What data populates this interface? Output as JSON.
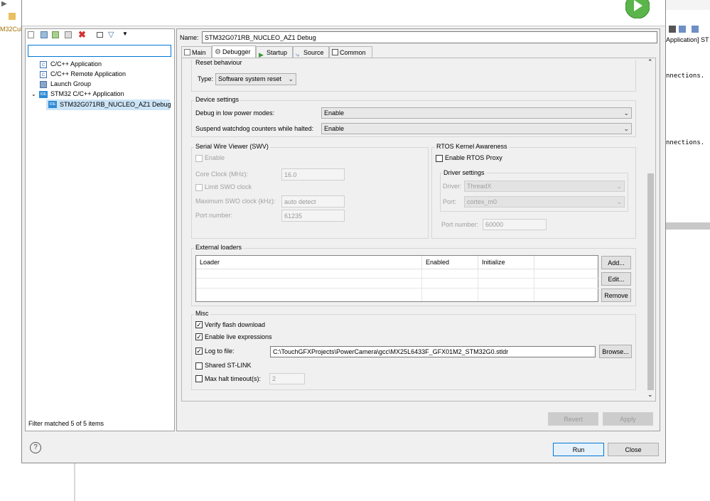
{
  "background": {
    "left_text": "M32Cub",
    "right_lines": [
      "Application] ST",
      "nnections.",
      "nnections."
    ]
  },
  "left": {
    "filter_placeholder": "",
    "tree": [
      {
        "label": "C/C++ Application",
        "icon": "c-app-icon"
      },
      {
        "label": "C/C++ Remote Application",
        "icon": "c-remote-app-icon"
      },
      {
        "label": "Launch Group",
        "icon": "launch-group-icon"
      },
      {
        "label": "STM32 C/C++ Application",
        "icon": "ide-icon"
      },
      {
        "label": "STM32G071RB_NUCLEO_AZ1 Debug",
        "icon": "ide-icon"
      }
    ],
    "status": "Filter matched 5 of 5 items"
  },
  "name": {
    "label": "Name:",
    "value": "STM32G071RB_NUCLEO_AZ1 Debug"
  },
  "tabs": [
    {
      "label": "Main"
    },
    {
      "label": "Debugger"
    },
    {
      "label": "Startup"
    },
    {
      "label": "Source"
    },
    {
      "label": "Common"
    }
  ],
  "reset": {
    "title": "Reset behaviour",
    "type_label": "Type:",
    "type_value": "Software system reset"
  },
  "device": {
    "title": "Device settings",
    "lowpower_label": "Debug in low power modes:",
    "lowpower_value": "Enable",
    "watchdog_label": "Suspend watchdog counters while halted:",
    "watchdog_value": "Enable"
  },
  "swv": {
    "title": "Serial Wire Viewer (SWV)",
    "enable": "Enable",
    "core_clock_label": "Core Clock (MHz):",
    "core_clock_value": "16.0",
    "limit_label": "Limit SWO clock",
    "max_swo_label": "Maximum SWO clock (kHz):",
    "max_swo_value": "auto detect",
    "port_label": "Port number:",
    "port_value": "61235"
  },
  "rtos": {
    "title": "RTOS Kernel Awareness",
    "proxy_label": "Enable RTOS Proxy",
    "driver_settings": "Driver settings",
    "driver_label": "Driver:",
    "driver_value": "ThreadX",
    "port_label": "Port:",
    "port_value": "cortex_m0",
    "portnum_label": "Port number:",
    "portnum_value": "60000"
  },
  "loaders": {
    "title": "External loaders",
    "columns": [
      "Loader",
      "Enabled",
      "Initialize",
      ""
    ],
    "add": "Add...",
    "edit": "Edit...",
    "remove": "Remove"
  },
  "misc": {
    "title": "Misc",
    "verify": "Verify flash download",
    "live": "Enable live expressions",
    "log_label": "Log to file:",
    "log_value": "C:\\TouchGFXProjects\\PowerCamera\\gcc\\MX25L6433F_GFX01M2_STM32G0.stldr",
    "browse": "Browse...",
    "shared": "Shared ST-LINK",
    "halt_label": "Max halt timeout(s):",
    "halt_value": "2"
  },
  "buttons": {
    "revert": "Revert",
    "apply": "Apply",
    "run": "Run",
    "close": "Close"
  },
  "colors": {
    "accent": "#0078d7",
    "run_green": "#4caf50"
  }
}
